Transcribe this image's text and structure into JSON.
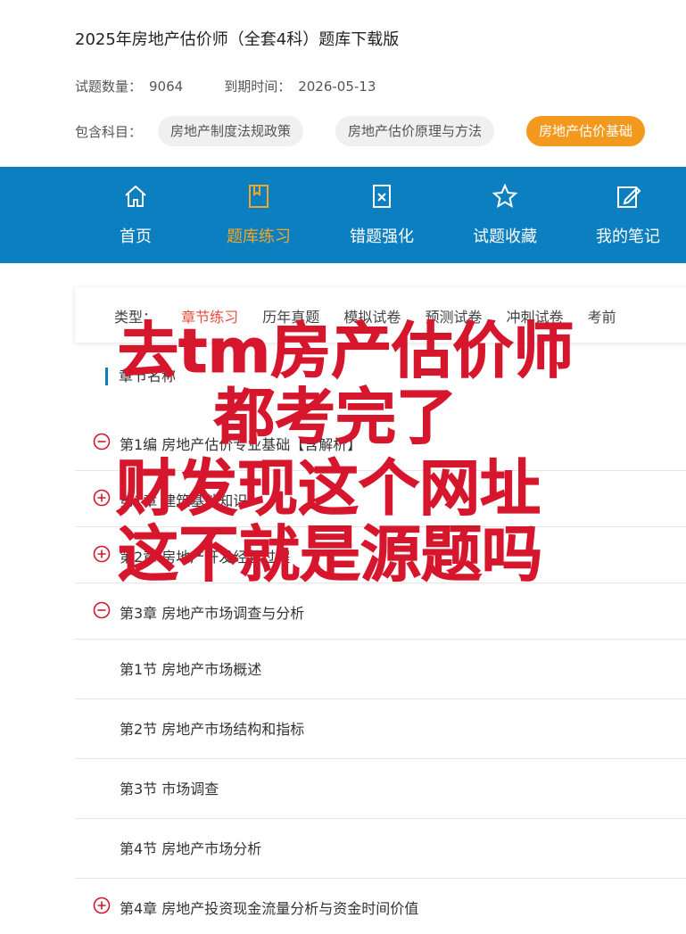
{
  "header": {
    "title": "2025年房地产估价师（全套4科）题库下载版",
    "count_label": "试题数量：",
    "count_value": "9064",
    "expire_label": "到期时间：",
    "expire_value": "2026-05-13",
    "subjects_label": "包含科目：",
    "subjects": [
      "房地产制度法规政策",
      "房地产估价原理与方法",
      "房地产估价基础"
    ]
  },
  "nav": {
    "items": [
      {
        "label": "首页",
        "icon": "home-icon"
      },
      {
        "label": "题库练习",
        "icon": "book-icon"
      },
      {
        "label": "错题强化",
        "icon": "wrong-icon"
      },
      {
        "label": "试题收藏",
        "icon": "star-icon"
      },
      {
        "label": "我的笔记",
        "icon": "note-icon"
      }
    ],
    "active_index": 1
  },
  "types": {
    "label": "类型：",
    "items": [
      "章节练习",
      "历年真题",
      "模拟试卷",
      "预测试卷",
      "冲刺试卷",
      "考前"
    ]
  },
  "chapters": {
    "header": "章节名称",
    "items": [
      {
        "text": "第1编 房地产估价专业基础【含解析】",
        "icon": "minus-circle-icon"
      },
      {
        "text": "第1章 建筑基础知识",
        "icon": "plus-circle-icon"
      },
      {
        "text": "第2章 房地产开发经营过程",
        "icon": "plus-circle-icon"
      },
      {
        "text": "第3章 房地产市场调查与分析",
        "icon": "minus-circle-icon"
      },
      {
        "text": "第1节 房地产市场概述",
        "icon": ""
      },
      {
        "text": "第2节 房地产市场结构和指标",
        "icon": ""
      },
      {
        "text": "第3节 市场调查",
        "icon": ""
      },
      {
        "text": "第4节 房地产市场分析",
        "icon": ""
      },
      {
        "text": "第4章 房地产投资现金流量分析与资金时间价值",
        "icon": "plus-circle-icon"
      }
    ]
  },
  "overlay": {
    "lines": [
      "去tm房产估价师",
      "都考完了",
      "财发现这个网址",
      "这不就是源题吗"
    ]
  },
  "colors": {
    "brand": "#0c7fc0",
    "accent": "#f39a1e",
    "red": "#e74c3c",
    "overlay_red": "#d6162d"
  }
}
